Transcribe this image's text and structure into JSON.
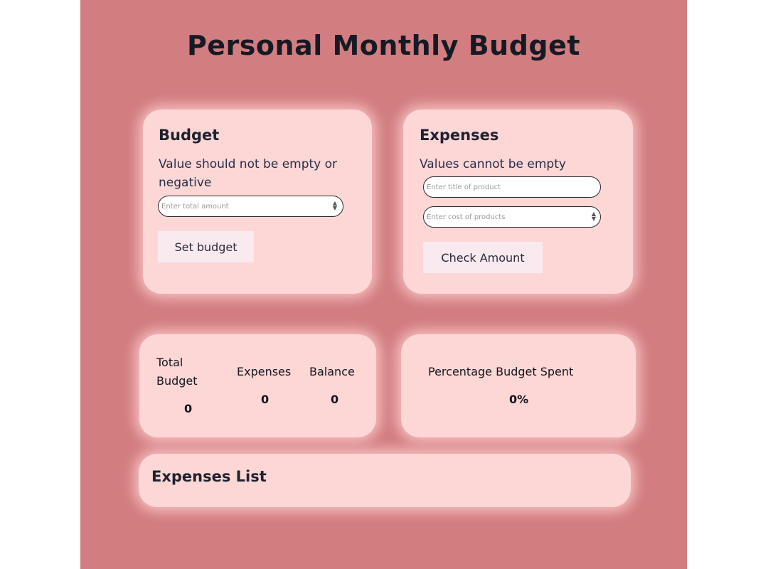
{
  "page": {
    "title": "Personal Monthly Budget"
  },
  "budget": {
    "heading": "Budget",
    "hint": "Value should not be empty or negative",
    "amount_placeholder": "Enter total amount",
    "set_button": "Set budget"
  },
  "expenses": {
    "heading": "Expenses",
    "hint": "Values cannot be empty",
    "title_placeholder": "Enter title of product",
    "cost_placeholder": "Enter cost of products",
    "check_button": "Check Amount"
  },
  "summary": {
    "total_budget_label": "Total Budget",
    "total_budget_value": "0",
    "expenses_label": "Expenses",
    "expenses_value": "0",
    "balance_label": "Balance",
    "balance_value": "0"
  },
  "percentage": {
    "label": "Percentage Budget Spent",
    "value": "0%"
  },
  "expenses_list": {
    "heading": "Expenses List"
  },
  "colors": {
    "background": "#d27d80",
    "card": "#fdd6d6",
    "button": "#f9eaf0"
  }
}
